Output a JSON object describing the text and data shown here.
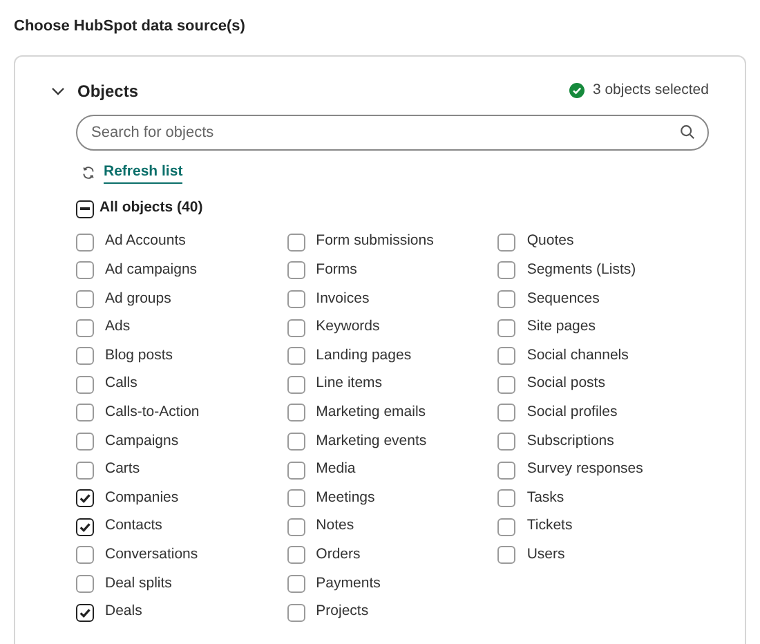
{
  "heading": "Choose HubSpot data source(s)",
  "section": {
    "title": "Objects",
    "expanded": true,
    "status": "3 objects selected"
  },
  "search": {
    "placeholder": "Search for objects"
  },
  "refresh": {
    "label": "Refresh list"
  },
  "all": {
    "label": "All objects (40)",
    "indeterminate": true
  },
  "columns": [
    [
      {
        "label": "Ad Accounts",
        "checked": false
      },
      {
        "label": "Ad campaigns",
        "checked": false
      },
      {
        "label": "Ad groups",
        "checked": false
      },
      {
        "label": "Ads",
        "checked": false
      },
      {
        "label": "Blog posts",
        "checked": false
      },
      {
        "label": "Calls",
        "checked": false
      },
      {
        "label": "Calls-to-Action",
        "checked": false
      },
      {
        "label": "Campaigns",
        "checked": false
      },
      {
        "label": "Carts",
        "checked": false
      },
      {
        "label": "Companies",
        "checked": true
      },
      {
        "label": "Contacts",
        "checked": true
      },
      {
        "label": "Conversations",
        "checked": false
      },
      {
        "label": "Deal splits",
        "checked": false
      },
      {
        "label": "Deals",
        "checked": true
      }
    ],
    [
      {
        "label": "Form submissions",
        "checked": false
      },
      {
        "label": "Forms",
        "checked": false
      },
      {
        "label": "Invoices",
        "checked": false
      },
      {
        "label": "Keywords",
        "checked": false
      },
      {
        "label": "Landing pages",
        "checked": false
      },
      {
        "label": "Line items",
        "checked": false
      },
      {
        "label": "Marketing emails",
        "checked": false
      },
      {
        "label": "Marketing events",
        "checked": false
      },
      {
        "label": "Media",
        "checked": false
      },
      {
        "label": "Meetings",
        "checked": false
      },
      {
        "label": "Notes",
        "checked": false
      },
      {
        "label": "Orders",
        "checked": false
      },
      {
        "label": "Payments",
        "checked": false
      },
      {
        "label": "Projects",
        "checked": false
      }
    ],
    [
      {
        "label": "Quotes",
        "checked": false
      },
      {
        "label": "Segments (Lists)",
        "checked": false
      },
      {
        "label": "Sequences",
        "checked": false
      },
      {
        "label": "Site pages",
        "checked": false
      },
      {
        "label": "Social channels",
        "checked": false
      },
      {
        "label": "Social posts",
        "checked": false
      },
      {
        "label": "Social profiles",
        "checked": false
      },
      {
        "label": "Subscriptions",
        "checked": false
      },
      {
        "label": "Survey responses",
        "checked": false
      },
      {
        "label": "Tasks",
        "checked": false
      },
      {
        "label": "Tickets",
        "checked": false
      },
      {
        "label": "Users",
        "checked": false
      }
    ]
  ]
}
